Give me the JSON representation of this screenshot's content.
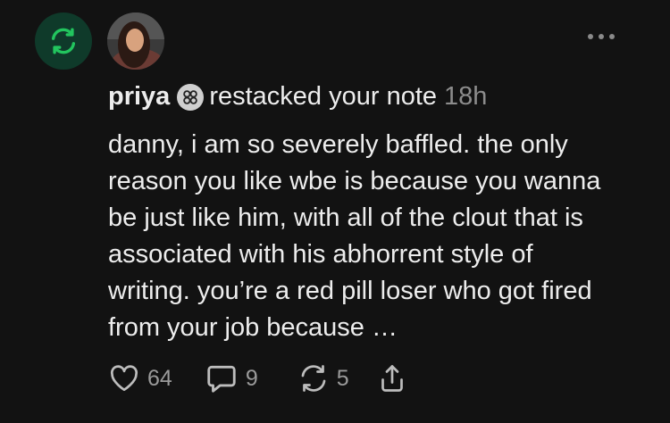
{
  "header": {
    "author": "priya",
    "action": "restacked your note",
    "time": "18h"
  },
  "note": {
    "text": "danny, i am so severely baffled. the only\nreason you like wbe is because you wanna\nbe just like him, with all of the clout that is\nassociated with his abhorrent style of\nwriting. you’re a red pill loser who got fired\nfrom your job because …"
  },
  "actions": {
    "likes": "64",
    "comments": "9",
    "restacks": "5"
  },
  "icons": {
    "badge": "restack-icon",
    "more": "more-dots-icon",
    "subscriber": "substack-badge-icon",
    "like": "heart-icon",
    "comment": "comment-icon",
    "restack": "restack-icon",
    "share": "share-icon"
  },
  "colors": {
    "background": "#121212",
    "badge_bg": "#0f3a2a",
    "badge_icon": "#22c55e",
    "muted": "#8c8c8c"
  }
}
